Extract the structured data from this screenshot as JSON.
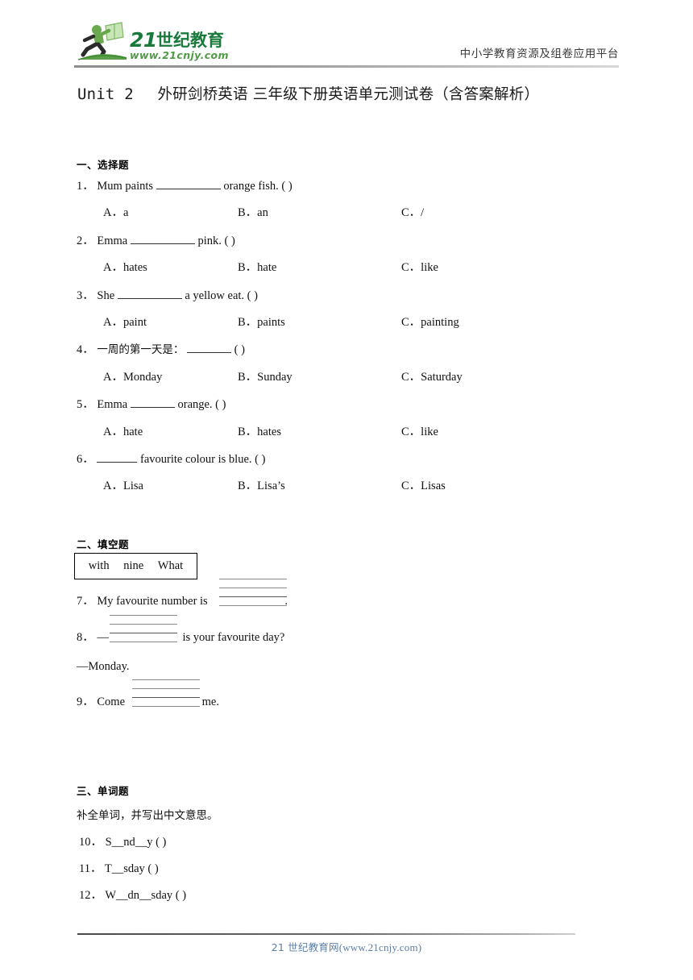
{
  "header": {
    "logo_brand": "21世纪教育",
    "logo_url": "www.21cnjy.com",
    "tagline": "中小学教育资源及组卷应用平台",
    "logo_icon": "running-student-with-book-icon",
    "brand_color_dark": "#1a7a3c",
    "brand_color_light": "#6aa84f"
  },
  "title": {
    "prefix": "Unit 2",
    "cn": "外研剑桥英语 三年级下册英语单元测试卷（含答案解析）"
  },
  "sections": [
    {
      "heading": "一、选择题",
      "questions": [
        {
          "num": "1．",
          "text_before": "Mum paints",
          "text_after": "orange fish. (    )",
          "blank_width": "w80",
          "options": [
            {
              "label": "A．",
              "value": "a"
            },
            {
              "label": "B．",
              "value": "an"
            },
            {
              "label": "C．",
              "value": "/"
            }
          ]
        },
        {
          "num": "2．",
          "text_before": "Emma",
          "text_after": "pink. (    )",
          "blank_width": "w80",
          "options": [
            {
              "label": "A．",
              "value": "hates"
            },
            {
              "label": "B．",
              "value": "hate"
            },
            {
              "label": "C．",
              "value": "like"
            }
          ]
        },
        {
          "num": "3．",
          "text_before": "She",
          "text_after": "a yellow eat. (    )",
          "blank_width": "w80",
          "options": [
            {
              "label": "A．",
              "value": "paint"
            },
            {
              "label": "B．",
              "value": "paints"
            },
            {
              "label": "C．",
              "value": "painting"
            }
          ]
        },
        {
          "num": "4．",
          "text_before": "一周的第一天是：",
          "text_after": "(    )",
          "blank_width": "w55",
          "options": [
            {
              "label": "A．",
              "value": "Monday"
            },
            {
              "label": "B．",
              "value": "Sunday"
            },
            {
              "label": "C．",
              "value": "Saturday"
            }
          ]
        },
        {
          "num": "5．",
          "text_before": "Emma",
          "text_after": "orange. (    )",
          "blank_width": "w55",
          "options": [
            {
              "label": "A．",
              "value": "hate"
            },
            {
              "label": "B．",
              "value": "hates"
            },
            {
              "label": "C．",
              "value": "like"
            }
          ]
        },
        {
          "num": "6．",
          "text_before": "",
          "text_after": "favourite colour is blue. (    )",
          "blank_width": "w50",
          "options": [
            {
              "label": "A．",
              "value": "Lisa"
            },
            {
              "label": "B．",
              "value": "Lisa’s"
            },
            {
              "label": "C．",
              "value": "Lisas"
            }
          ]
        }
      ]
    },
    {
      "heading": "二、填空题",
      "word_bank": [
        "with",
        "nine",
        "What"
      ],
      "fill_questions": [
        {
          "num": "7．",
          "before": "My favourite number is",
          "after": "."
        },
        {
          "num": "8．",
          "before": "—",
          "after": "is your favourite day?",
          "answer_line": "—Monday."
        },
        {
          "num": "9．",
          "before": "Come",
          "after": "me."
        }
      ]
    },
    {
      "heading": "三、单词题",
      "instruction": "补全单词，并写出中文意思。",
      "word_questions": [
        {
          "num": "10．",
          "text": "S__nd__y (          )"
        },
        {
          "num": "11．",
          "text": "T__sday (          )"
        },
        {
          "num": "12．",
          "text": "W__dn__sday (          )"
        }
      ]
    }
  ],
  "footer": {
    "cn": "21 世纪教育网",
    "url": "(www.21cnjy.com)"
  }
}
